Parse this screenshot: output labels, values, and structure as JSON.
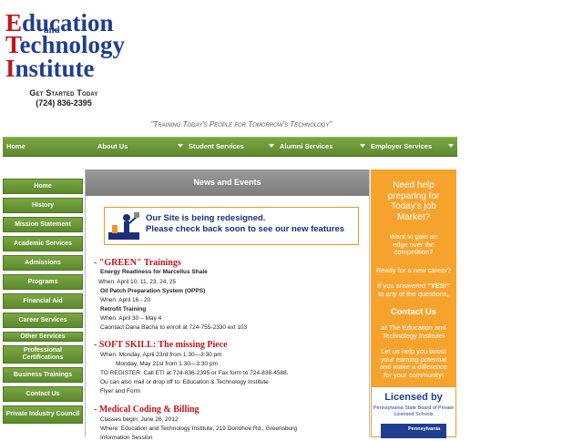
{
  "logo": {
    "word1_letter": "E",
    "word1_rest": "ducation",
    "and": "and",
    "word2_letter": "T",
    "word2_rest": "echnology",
    "word3_letter": "I",
    "word3_rest": "nstitute"
  },
  "cta": {
    "title": "Get Started Today",
    "phone": "(724) 836-2395"
  },
  "tagline": "\"Training Today's People for Tomorrow's Technology\"",
  "nav": [
    {
      "label": "Home"
    },
    {
      "label": "About Us"
    },
    {
      "label": "Student Services"
    },
    {
      "label": "Alumni Services"
    },
    {
      "label": "Employer Services"
    }
  ],
  "sidebar": [
    {
      "label": "Home"
    },
    {
      "label": "History"
    },
    {
      "label": "Mission Statement"
    },
    {
      "label": "Academic Services"
    },
    {
      "label": "Admissions"
    },
    {
      "label": "Programs"
    },
    {
      "label": "Financial Aid"
    },
    {
      "label": "Career Services"
    },
    {
      "label": "Other Services"
    },
    {
      "label": "Professional Certifications"
    },
    {
      "label": "Business Trainings"
    },
    {
      "label": "Contact Us"
    },
    {
      "label": "Private Industry Council"
    }
  ],
  "main": {
    "heading": "News and Events",
    "banner_line1": "Our Site is being redesigned.",
    "banner_line2": "Please check back soon to see our new features",
    "sections": [
      {
        "title": "- \"GREEN\" Trainings",
        "lines": [
          {
            "text": "Energy Readiness for Marcellus Shale",
            "bold": true
          },
          {
            "text": "When: April 10, 11, 23, 24, 25",
            "bold": false
          },
          {
            "text": "Oil Patch Preparation System (OPPS)",
            "bold": true
          },
          {
            "text": "When: April 16 - 20",
            "bold": false
          },
          {
            "text": "Retrofit Training",
            "bold": true
          },
          {
            "text": "When: April 30 – May 4",
            "bold": false
          },
          {
            "text": "Caontact Dana Bacha to enroll at 724-755-2330 ext 103",
            "bold": false
          }
        ]
      },
      {
        "title": "- SOFT SKILL: The missing Piece",
        "lines": [
          {
            "text": "When: Monday, April 23rd from 1:30—3:30 pm",
            "bold": false
          },
          {
            "text": "Monday, May 21st from 1:30—3:30 pm",
            "bold": false
          },
          {
            "text": "TO REGISTER: Call ETI at 724-836-2395 or Fax form to 724-836-4588.",
            "bold": false
          },
          {
            "text": "Ou can also mail or drop off to: Education & Technology Institute",
            "bold": false
          },
          {
            "text": "Flyer and Form",
            "bold": false
          }
        ]
      },
      {
        "title": "- Medical Coding & Billing",
        "lines": [
          {
            "text": "Classes begin: June 26, 2012",
            "bold": false
          },
          {
            "text": "Where: Education and Technology Institute, 219 Donohoe Rd., Greensburg",
            "bold": false
          },
          {
            "text": "Information Session",
            "bold": false
          }
        ]
      }
    ]
  },
  "promo": {
    "headline": "Need help preparing for Today's job Market?",
    "p1": "Want to gain an edge over the competition?",
    "p2": "Ready for a new career?",
    "p3_pre": "If you answered",
    "p3_yes": "\"YES!\"",
    "p3_post": "to any of the questions,",
    "contact": "Contact Us",
    "p4": "at The Education and Technology Institute!",
    "p5": "Let us help you boost your earning potential and make a difference for your community!"
  },
  "licensed": {
    "title": "Licensed by",
    "board": "Pennsylvania State Board of Private Licensed Schools",
    "seal_text": "Pennsylvania"
  },
  "colors": {
    "nav_green": "#6a9a38",
    "logo_red": "#c0161b",
    "logo_blue": "#1f3f8f",
    "promo_orange": "#f6a32e",
    "section_red": "#c0161b"
  }
}
